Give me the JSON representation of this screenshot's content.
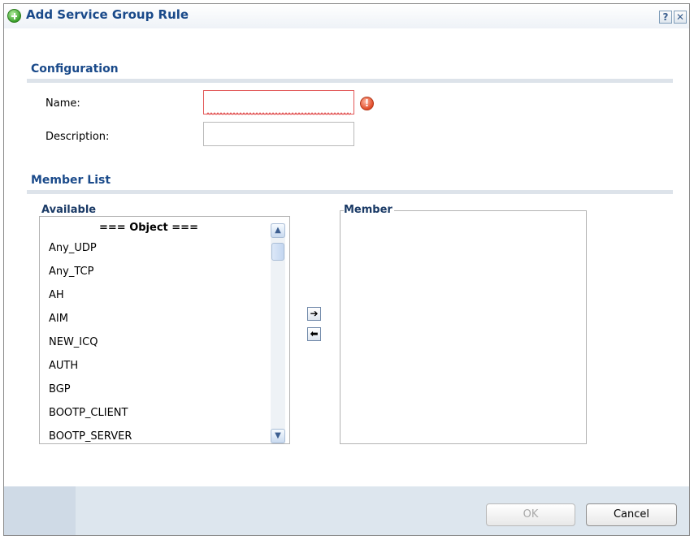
{
  "dialog": {
    "title": "Add Service Group Rule",
    "help_label": "?",
    "close_label": "✕"
  },
  "configuration": {
    "section_title": "Configuration",
    "name_label": "Name:",
    "name_value": "",
    "description_label": "Description:",
    "description_value": "",
    "error_glyph": "!"
  },
  "member_list": {
    "section_title": "Member List",
    "available_legend": "Available",
    "member_legend": "Member",
    "available_header": "=== Object ===",
    "available_items": [
      "Any_UDP",
      "Any_TCP",
      "AH",
      "AIM",
      "NEW_ICQ",
      "AUTH",
      "BGP",
      "BOOTP_CLIENT",
      "BOOTP_SERVER"
    ],
    "member_items": [],
    "add_glyph": "➔",
    "remove_glyph": "⬅"
  },
  "footer": {
    "ok_label": "OK",
    "cancel_label": "Cancel"
  },
  "colors": {
    "title": "#1a4a8a",
    "error": "#e25757",
    "footer_bg": "#dde6ee"
  }
}
